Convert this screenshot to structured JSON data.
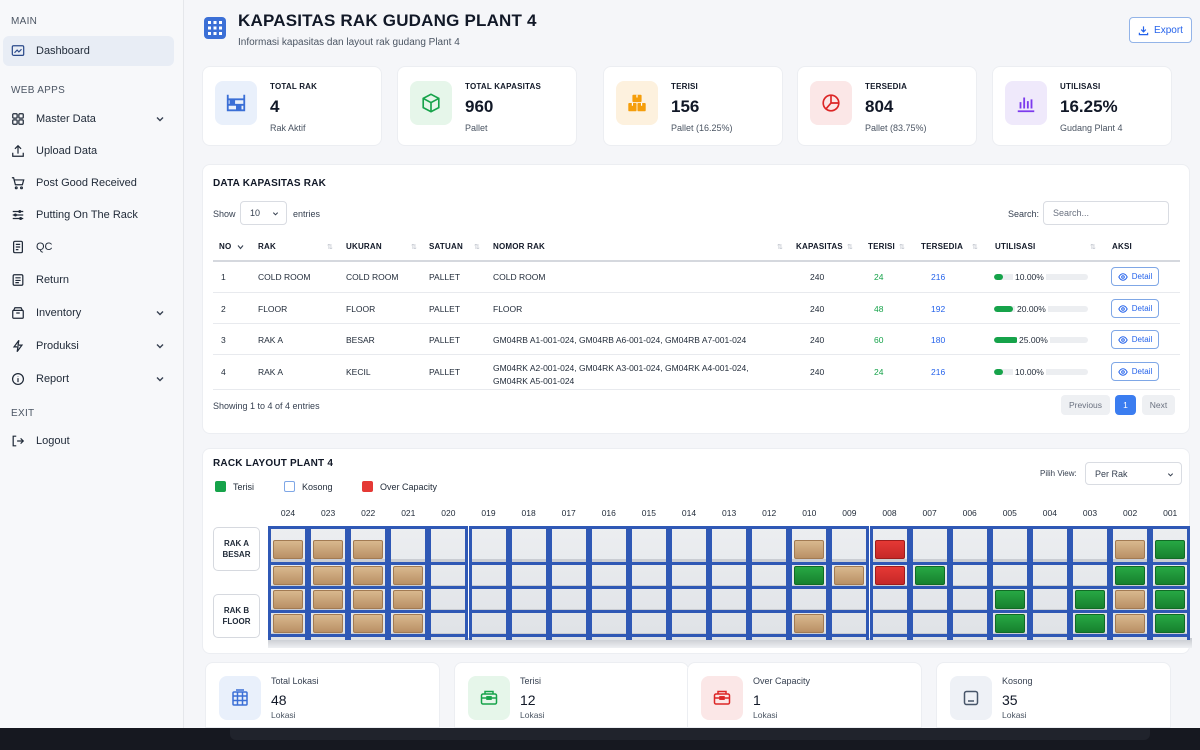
{
  "sidebar": {
    "sections": {
      "main": "MAIN",
      "web_apps": "WEB APPS",
      "exit": "EXIT"
    },
    "items": [
      {
        "label": "Dashboard",
        "icon": "dashboard-icon",
        "active": true
      },
      {
        "label": "Master Data",
        "icon": "grid-icon",
        "has_submenu": true
      },
      {
        "label": "Upload Data",
        "icon": "upload-icon"
      },
      {
        "label": "Post Good Received",
        "icon": "cart-icon"
      },
      {
        "label": "Putting On The Rack",
        "icon": "list-icon"
      },
      {
        "label": "QC",
        "icon": "document-icon"
      },
      {
        "label": "Return",
        "icon": "receipt-icon"
      },
      {
        "label": "Inventory",
        "icon": "box-icon",
        "has_submenu": true
      },
      {
        "label": "Produksi",
        "icon": "bolt-icon",
        "has_submenu": true
      },
      {
        "label": "Report",
        "icon": "info-icon",
        "has_submenu": true
      },
      {
        "label": "Logout",
        "icon": "logout-icon"
      }
    ]
  },
  "header": {
    "title": "KAPASITAS RAK GUDANG PLANT 4",
    "subtitle": "Informasi kapasitas dan layout rak gudang Plant 4",
    "export_label": "Export"
  },
  "stats": [
    {
      "label": "TOTAL RAK",
      "value": "4",
      "sub": "Rak Aktif",
      "icon": "rack-icon",
      "color": "#3b6fd6",
      "bg": "#e9f0fb"
    },
    {
      "label": "TOTAL KAPASITAS",
      "value": "960",
      "sub": "Pallet",
      "icon": "cube-icon",
      "color": "#16a34a",
      "bg": "#e6f6ea"
    },
    {
      "label": "TERISI",
      "value": "156",
      "sub": "Pallet (16.25%)",
      "icon": "boxes-icon",
      "color": "#f59e0b",
      "bg": "#fdf1de"
    },
    {
      "label": "TERSEDIA",
      "value": "804",
      "sub": "Pallet (83.75%)",
      "icon": "pie-chart-icon",
      "color": "#dc2626",
      "bg": "#fbe7e7"
    },
    {
      "label": "UTILISASI",
      "value": "16.25%",
      "sub": "Gudang Plant 4",
      "icon": "bar-chart-icon",
      "color": "#7c3aed",
      "bg": "#efe9fb"
    }
  ],
  "table": {
    "title": "DATA KAPASITAS RAK",
    "show_label": "Show",
    "entries_value": "10",
    "entries_label": "entries",
    "search_label": "Search:",
    "search_placeholder": "Search...",
    "columns": [
      "NO",
      "RAK",
      "UKURAN",
      "SATUAN",
      "NOMOR RAK",
      "KAPASITAS",
      "TERISI",
      "TERSEDIA",
      "UTILISASI",
      "AKSI"
    ],
    "rows": [
      {
        "no": "1",
        "rak": "COLD ROOM",
        "ukuran": "COLD ROOM",
        "satuan": "PALLET",
        "nomor": [
          "COLD ROOM"
        ],
        "kapasitas": "240",
        "terisi": "24",
        "tersedia": "216",
        "util": "10.00%",
        "util_frac": 0.1
      },
      {
        "no": "2",
        "rak": "FLOOR",
        "ukuran": "FLOOR",
        "satuan": "PALLET",
        "nomor": [
          "FLOOR"
        ],
        "kapasitas": "240",
        "terisi": "48",
        "tersedia": "192",
        "util": "20.00%",
        "util_frac": 0.2
      },
      {
        "no": "3",
        "rak": "RAK A",
        "ukuran": "BESAR",
        "satuan": "PALLET",
        "nomor": [
          "GM04RB A1-001-024, GM04RB A6-001-024, GM04RB A7-001-024"
        ],
        "kapasitas": "240",
        "terisi": "60",
        "tersedia": "180",
        "util": "25.00%",
        "util_frac": 0.25
      },
      {
        "no": "4",
        "rak": "RAK A",
        "ukuran": "KECIL",
        "satuan": "PALLET",
        "nomor": [
          "GM04RK A2-001-024, GM04RK A3-001-024, GM04RK A4-001-024,",
          "GM04RK A5-001-024"
        ],
        "kapasitas": "240",
        "terisi": "24",
        "tersedia": "216",
        "util": "10.00%",
        "util_frac": 0.1
      }
    ],
    "detail_label": "Detail",
    "showing": "Showing 1 to 4 of 4 entries",
    "pagination": {
      "prev": "Previous",
      "page": "1",
      "next": "Next"
    }
  },
  "layout": {
    "title": "RACK LAYOUT PLANT 4",
    "legend": [
      {
        "label": "Terisi",
        "color": "#16a34a"
      },
      {
        "label": "Kosong",
        "color": "#ffffff"
      },
      {
        "label": "Over Capacity",
        "color": "#e53935"
      }
    ],
    "view_label": "Pilih View:",
    "view_value": "Per Rak",
    "columns": [
      "024",
      "023",
      "022",
      "021",
      "020",
      "019",
      "018",
      "017",
      "016",
      "015",
      "014",
      "013",
      "012",
      "010",
      "009",
      "008",
      "007",
      "006",
      "005",
      "004",
      "003",
      "002",
      "001"
    ],
    "rack_labels": [
      "RAK A BESAR",
      "RAK B FLOOR"
    ],
    "bays": [
      [
        "filled",
        "filled",
        "filled",
        "filled"
      ],
      [
        "filled",
        "filled",
        "filled",
        "filled"
      ],
      [
        "filled",
        "filled",
        "filled",
        "filled"
      ],
      [
        "empty",
        "filled",
        "filled",
        "filled"
      ],
      [
        "empty",
        "empty",
        "empty",
        "empty"
      ],
      [
        "empty",
        "empty",
        "empty",
        "empty"
      ],
      [
        "empty",
        "empty",
        "empty",
        "empty"
      ],
      [
        "empty",
        "empty",
        "empty",
        "empty"
      ],
      [
        "empty",
        "empty",
        "empty",
        "empty"
      ],
      [
        "empty",
        "empty",
        "empty",
        "empty"
      ],
      [
        "empty",
        "empty",
        "empty",
        "empty"
      ],
      [
        "empty",
        "empty",
        "empty",
        "empty"
      ],
      [
        "empty",
        "empty",
        "empty",
        "empty"
      ],
      [
        "filled",
        "occ",
        "empty",
        "filled"
      ],
      [
        "empty",
        "filled",
        "empty",
        "empty"
      ],
      [
        "over",
        "over",
        "empty",
        "empty"
      ],
      [
        "empty",
        "occ",
        "empty",
        "empty"
      ],
      [
        "empty",
        "empty",
        "empty",
        "empty"
      ],
      [
        "empty",
        "empty",
        "occ",
        "occ"
      ],
      [
        "empty",
        "empty",
        "empty",
        "empty"
      ],
      [
        "empty",
        "empty",
        "occ",
        "occ"
      ],
      [
        "filled",
        "occ",
        "filled",
        "filled"
      ],
      [
        "occ",
        "occ",
        "occ",
        "occ"
      ]
    ]
  },
  "summary": [
    {
      "label": "Total Lokasi",
      "value": "48",
      "sub": "Lokasi",
      "icon": "building-icon",
      "color": "#3b6fd6",
      "bg": "#e9f0fb"
    },
    {
      "label": "Terisi",
      "value": "12",
      "sub": "Lokasi",
      "icon": "inbox-full-icon",
      "color": "#16a34a",
      "bg": "#e6f6ea"
    },
    {
      "label": "Over Capacity",
      "value": "1",
      "sub": "Lokasi",
      "icon": "inbox-alert-icon",
      "color": "#dc2626",
      "bg": "#fbe7e7"
    },
    {
      "label": "Kosong",
      "value": "35",
      "sub": "Lokasi",
      "icon": "empty-box-icon",
      "color": "#475569",
      "bg": "#eef1f6"
    }
  ]
}
